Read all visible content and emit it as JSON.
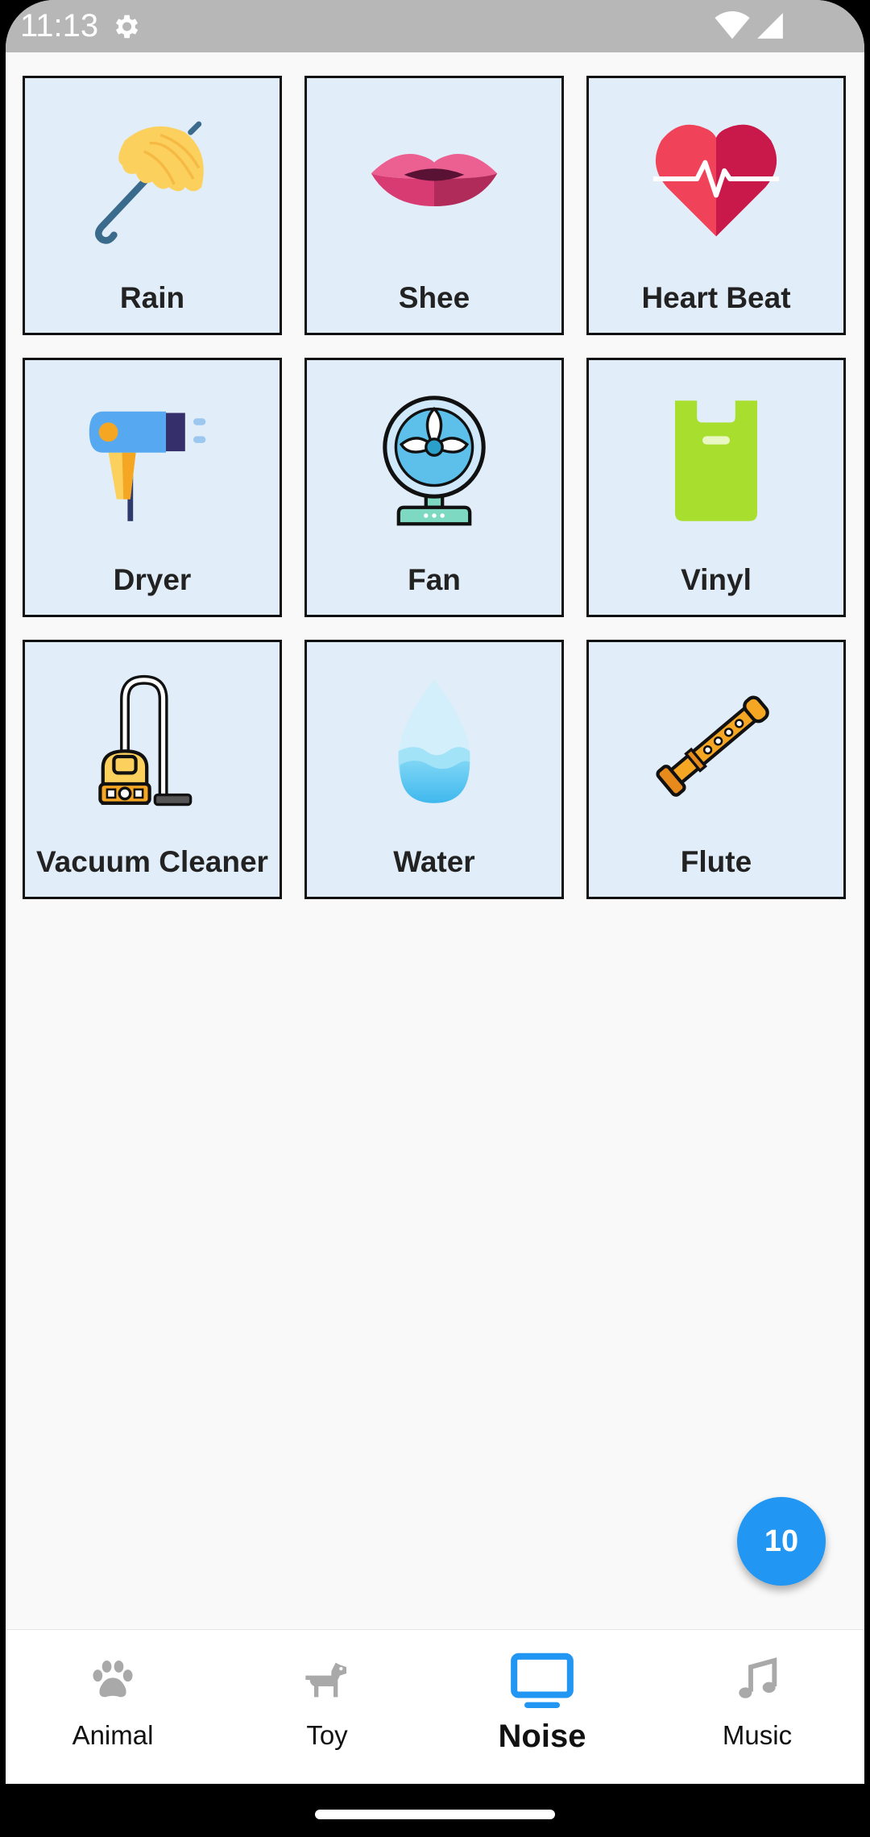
{
  "status_bar": {
    "time": "11:13"
  },
  "tiles": [
    {
      "label": "Rain",
      "icon": "umbrella-icon"
    },
    {
      "label": "Shee",
      "icon": "lips-icon"
    },
    {
      "label": "Heart Beat",
      "icon": "heart-icon"
    },
    {
      "label": "Dryer",
      "icon": "hair-dryer-icon"
    },
    {
      "label": "Fan",
      "icon": "fan-icon"
    },
    {
      "label": "Vinyl",
      "icon": "plastic-bag-icon"
    },
    {
      "label": "Vacuum Cleaner",
      "icon": "vacuum-cleaner-icon"
    },
    {
      "label": "Water",
      "icon": "water-drop-icon"
    },
    {
      "label": "Flute",
      "icon": "flute-icon"
    }
  ],
  "fab": {
    "label": "10"
  },
  "bottom_nav": {
    "items": [
      {
        "label": "Animal",
        "icon": "paw-icon",
        "active": false
      },
      {
        "label": "Toy",
        "icon": "toy-dog-icon",
        "active": false
      },
      {
        "label": "Noise",
        "icon": "tv-icon",
        "active": true
      },
      {
        "label": "Music",
        "icon": "music-note-icon",
        "active": false
      }
    ]
  },
  "colors": {
    "accent": "#2196f3",
    "tile_background": "#e1edf8",
    "inactive_icon": "#a9a9a9",
    "status_bar": "#b7b7b7"
  }
}
